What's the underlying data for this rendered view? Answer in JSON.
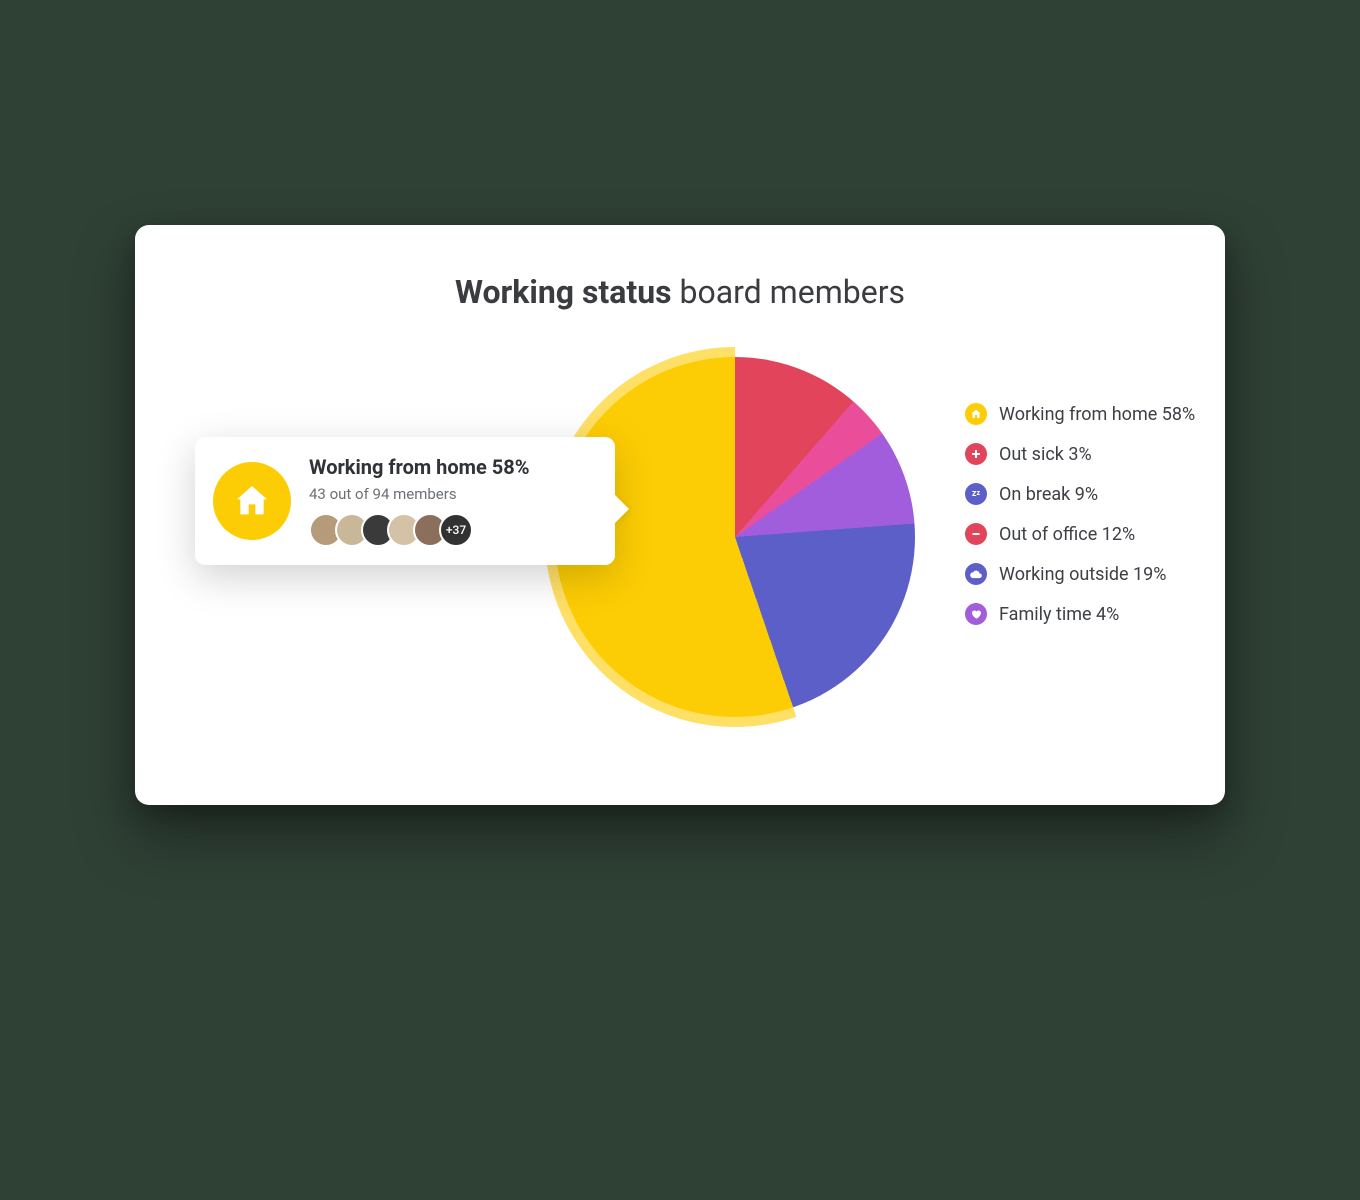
{
  "title_bold": "Working status",
  "title_rest": "board members",
  "chart_data": {
    "type": "pie",
    "title": "Working status board members",
    "series": [
      {
        "name": "Working from home",
        "value": 58,
        "label": "Working from home 58%",
        "color": "#fccd04",
        "icon": "home"
      },
      {
        "name": "Out sick",
        "value": 3,
        "label": "Out sick 3%",
        "color": "#e2445c",
        "icon": "plus"
      },
      {
        "name": "On break",
        "value": 9,
        "label": "On break 9%",
        "color": "#5b5fc7",
        "icon": "zz"
      },
      {
        "name": "Out of office",
        "value": 12,
        "label": "Out of office 12%",
        "color": "#e2445c",
        "icon": "stop"
      },
      {
        "name": "Working outside",
        "value": 19,
        "label": "Working outside 19%",
        "color": "#5b5fc7",
        "icon": "cloud"
      },
      {
        "name": "Family time",
        "value": 4,
        "label": "Family time 4%",
        "color": "#a25ddc",
        "icon": "heart"
      }
    ],
    "pie_render_order": [
      "Out of office",
      "Family time",
      "On break",
      "Out sick",
      "Working outside",
      "Working from home"
    ],
    "pie_colors_order": [
      "#e2445c",
      "#ea4d9a",
      "#a25ddc",
      "#5b5fc7",
      "#5b5fc7",
      "#fccd04"
    ],
    "highlight_series": "Working from home",
    "highlight_color": "#ffe066"
  },
  "tooltip": {
    "title": "Working from home 58%",
    "subtitle": "43 out of 94 members",
    "icon_bg": "#fccd04",
    "avatars_shown": 5,
    "overflow_label": "+37"
  },
  "legend": {
    "items": [
      {
        "label": "Working from home 58%",
        "bg": "#fccd04",
        "icon": "home"
      },
      {
        "label": "Out sick 3%",
        "bg": "#e2445c",
        "icon": "plus"
      },
      {
        "label": "On break 9%",
        "bg": "#5b5fc7",
        "icon": "zz"
      },
      {
        "label": "Out of office 12%",
        "bg": "#e2445c",
        "icon": "stop"
      },
      {
        "label": "Working outside 19%",
        "bg": "#5b5fc7",
        "icon": "cloud"
      },
      {
        "label": "Family time 4%",
        "bg": "#a25ddc",
        "icon": "heart"
      }
    ]
  },
  "avatar_colors": [
    "#b59b7a",
    "#c9b79a",
    "#3a3a3a",
    "#d4c2a6",
    "#8b6f5c"
  ]
}
